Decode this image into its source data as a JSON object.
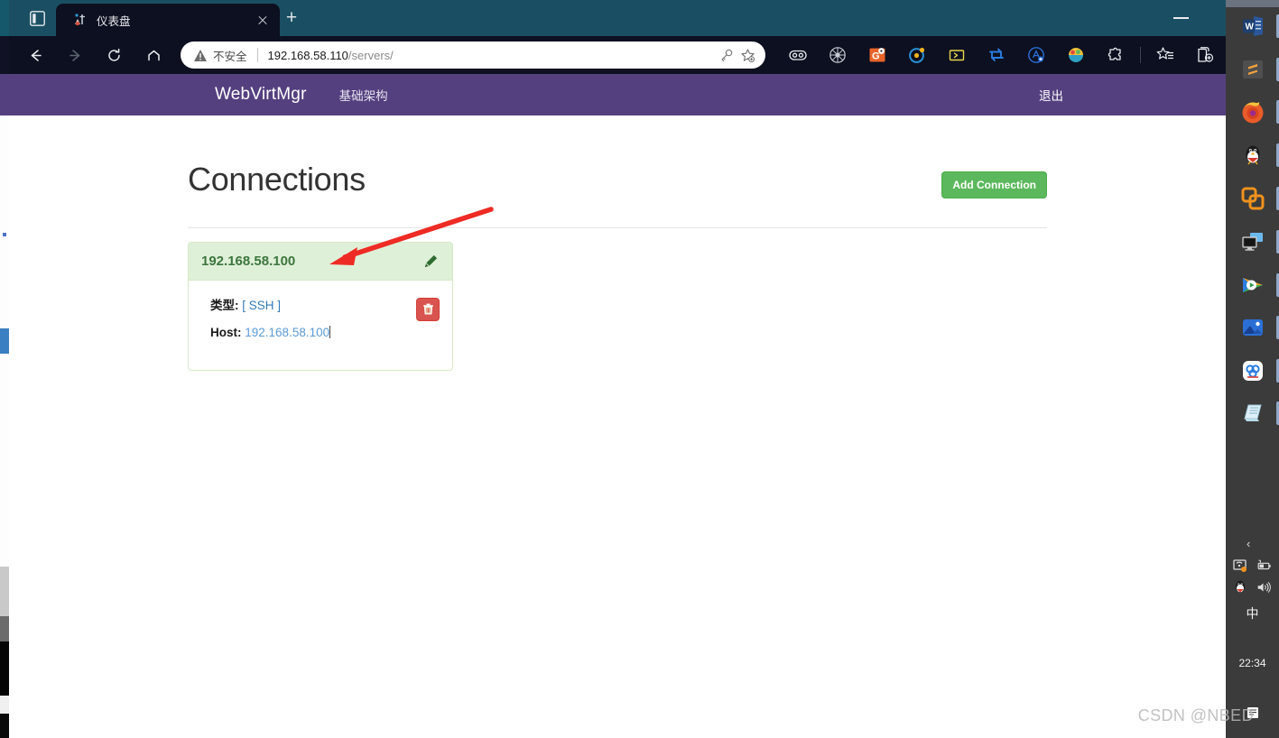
{
  "browser": {
    "tab": {
      "title": "仪表盘",
      "favicon": "globe-favicon"
    },
    "newtab_label": "+",
    "address": {
      "security_label": "不安全",
      "url_host": "192.168.58.110",
      "url_path": "/servers/"
    },
    "nav": {
      "back": "back-arrow",
      "forward": "forward-arrow",
      "reload": "reload",
      "home": "home"
    },
    "extensions": [
      "monocle-extension-icon",
      "spider-extension-icon",
      "grammar-extension-icon",
      "target-extension-icon",
      "console-extension-icon",
      "sync-extension-icon",
      "adblock-extension-icon",
      "color-extension-icon",
      "puzzle-extension-icon"
    ],
    "collections_icon": "collections-icon",
    "favorites_icon": "favorites-icon",
    "minimize_label": "minimize"
  },
  "site": {
    "navbar": {
      "brand": "WebVirtMgr",
      "links": [
        "基础架构"
      ],
      "logout": "退出"
    },
    "page_title": "Connections",
    "add_button": "Add Connection",
    "connections": [
      {
        "name": "192.168.58.100",
        "type_label": "类型:",
        "type_value": "[ SSH ]",
        "host_label": "Host:",
        "host_value": "192.168.58.100",
        "edit_icon": "pencil-icon",
        "delete_icon": "trash-icon"
      }
    ]
  },
  "annotation": {
    "arrow_color": "#ee2b24"
  },
  "taskbar": {
    "apps": [
      "word-icon",
      "sublime-text-icon",
      "firefox-icon",
      "qq-icon",
      "vmware-icon",
      "remote-desktop-icon",
      "tencent-video-icon",
      "photos-icon",
      "baidu-netdisk-icon",
      "notepad-icon"
    ],
    "tray": {
      "chevron": "‹",
      "icons": [
        "network-icon",
        "battery-icon",
        "qq-tray-icon",
        "volume-icon"
      ],
      "ime": "中",
      "clock": "22:34",
      "notification": "notification-icon"
    }
  },
  "watermark": "CSDN @NBED",
  "colors": {
    "tabstrip": "#1a4f63",
    "toolbar": "#0c1020",
    "navbar_purple": "#54407f",
    "panel_header_green": "#dff0d8",
    "panel_title_green": "#3c763d",
    "add_button_green": "#5cb85c",
    "delete_button_red": "#d9534f",
    "link_blue": "#5b9bd5",
    "taskbar_gray": "#3b3b3b"
  }
}
